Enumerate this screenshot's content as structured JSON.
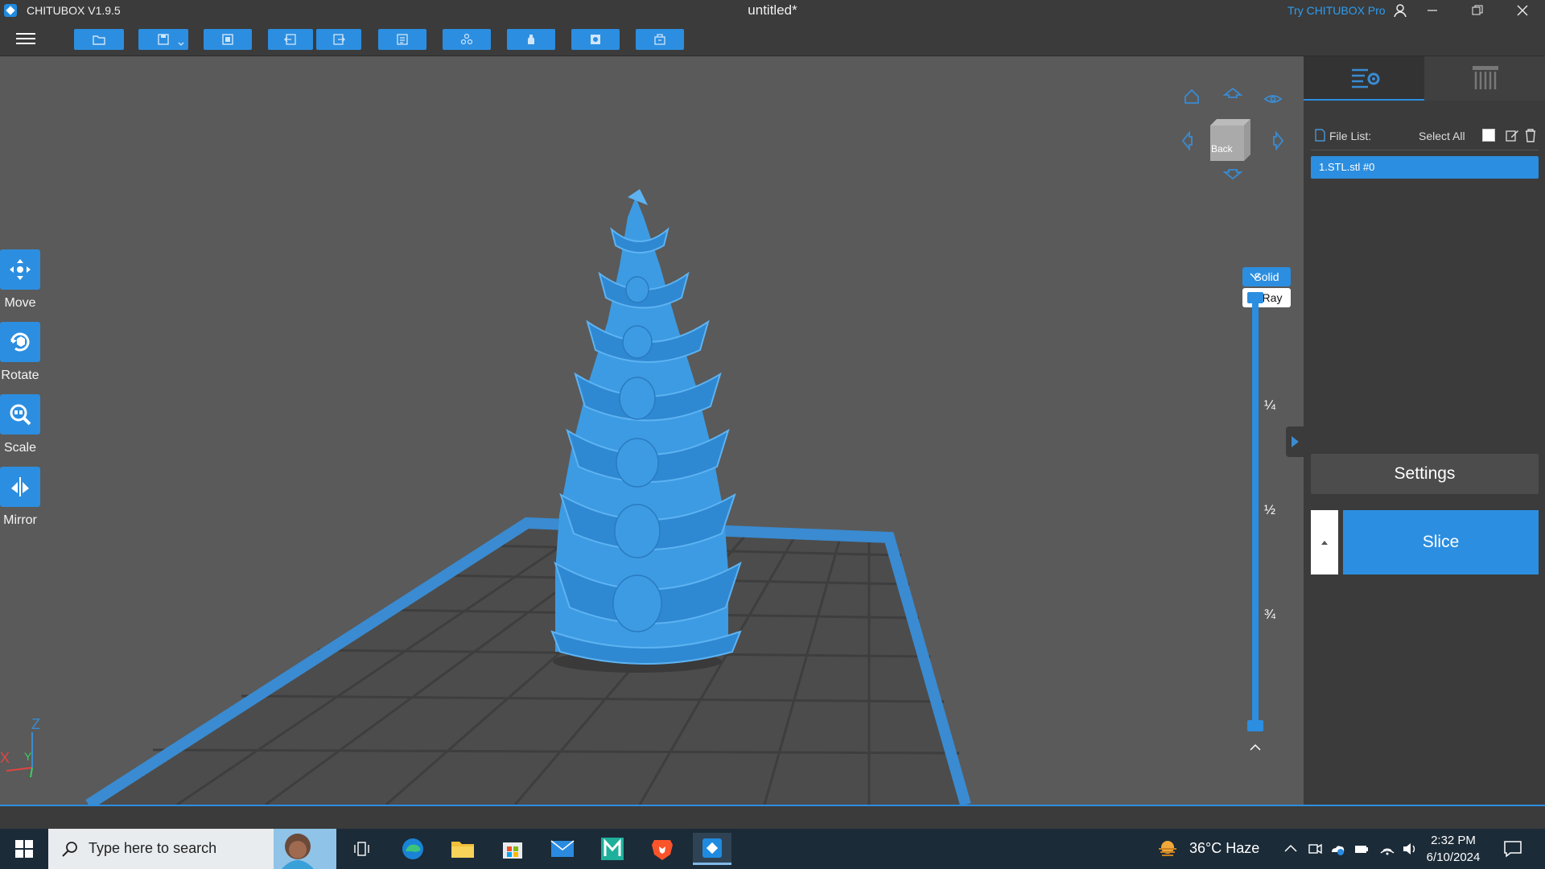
{
  "titlebar": {
    "app_name": "CHITUBOX V1.9.5",
    "doc_title": "untitled*",
    "try_pro": "Try CHITUBOX Pro"
  },
  "toolbar": {
    "buttons": [
      "open-file-icon",
      "save-icon",
      "screenshot-icon",
      "undo-icon",
      "redo-icon",
      "layout-icon",
      "duplicate-icon",
      "hollow-icon",
      "support-icon",
      "print-settings-icon"
    ]
  },
  "left_tools": [
    {
      "label": "Move",
      "icon": "move-icon"
    },
    {
      "label": "Rotate",
      "icon": "rotate-icon"
    },
    {
      "label": "Scale",
      "icon": "scale-icon"
    },
    {
      "label": "Mirror",
      "icon": "mirror-icon"
    }
  ],
  "view": {
    "cube_face": "Back",
    "mode_solid": "Solid",
    "mode_xray": "X-Ray"
  },
  "slider": {
    "marks": [
      "¼",
      "½",
      "¾"
    ]
  },
  "axis": {
    "x": "X",
    "y": "Y",
    "z": "Z"
  },
  "panel": {
    "file_list_label": "File List:",
    "select_all_label": "Select All",
    "files": [
      "1.STL.stl #0"
    ],
    "settings_label": "Settings",
    "slice_label": "Slice"
  },
  "taskbar": {
    "search_placeholder": "Type here to search",
    "weather": "36°C  Haze",
    "time": "2:32 PM",
    "date": "6/10/2024"
  },
  "colors": {
    "accent": "#2c8ee0",
    "model": "#3d9be3",
    "chrome": "#3b3b3b",
    "viewport": "#5a5a5a",
    "taskbar": "#1b2b38"
  }
}
